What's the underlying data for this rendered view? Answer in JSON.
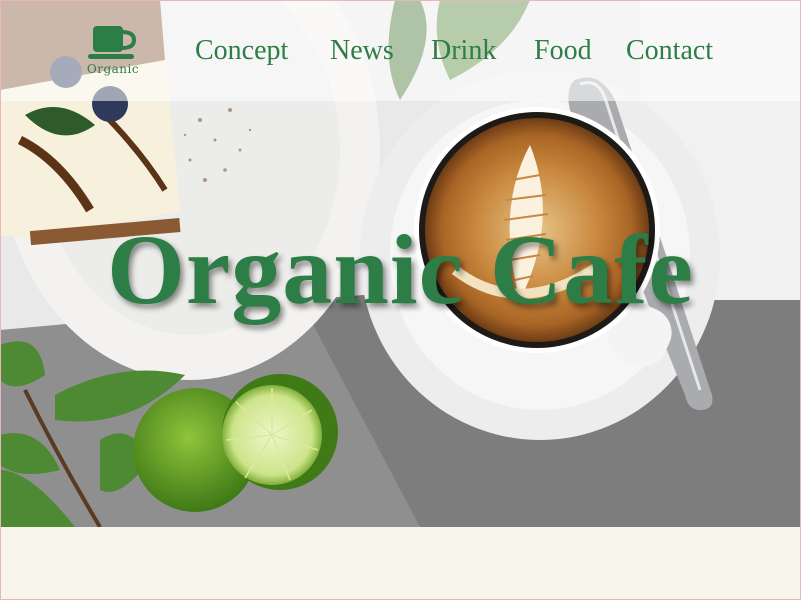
{
  "brand": {
    "logo_text": "Organic",
    "logo_icon": "coffee-cup-icon"
  },
  "nav": {
    "items": [
      {
        "label": "Concept"
      },
      {
        "label": "News"
      },
      {
        "label": "Drink"
      },
      {
        "label": "Food"
      },
      {
        "label": "Contact"
      }
    ]
  },
  "hero": {
    "title": "Organic Cafe"
  },
  "colors": {
    "accent": "#2d7d46",
    "page_background": "#f8f5ea"
  }
}
